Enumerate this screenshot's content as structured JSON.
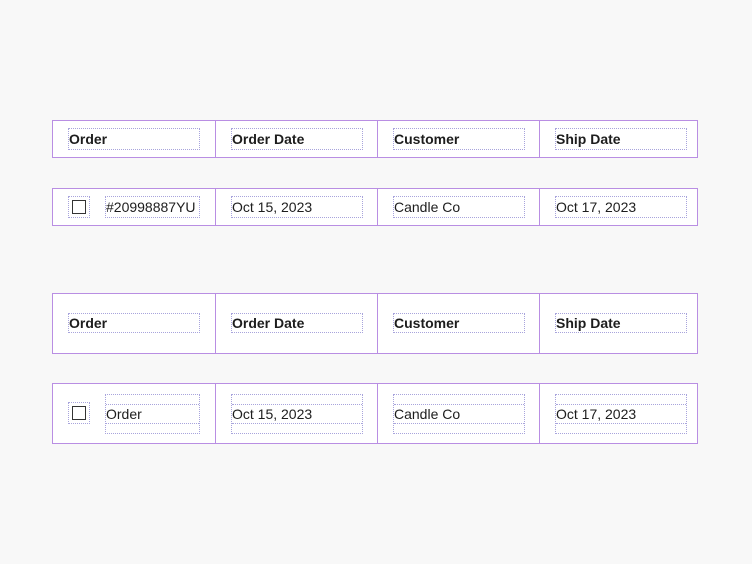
{
  "table1": {
    "headers": [
      "Order",
      "Order Date",
      "Customer",
      "Ship Date"
    ],
    "row": {
      "order": "#20998887YU",
      "order_date": "Oct 15, 2023",
      "customer": "Candle Co",
      "ship_date": "Oct 17, 2023"
    }
  },
  "table2": {
    "headers": [
      "Order",
      "Order Date",
      "Customer",
      "Ship Date"
    ],
    "row": {
      "order": "Order",
      "order_date": "Oct 15, 2023",
      "customer": "Candle Co",
      "ship_date": "Oct 17, 2023"
    }
  },
  "colors": {
    "border": "#b98ee3",
    "guide": "#a8a4dc",
    "background": "#f8f8f8"
  }
}
